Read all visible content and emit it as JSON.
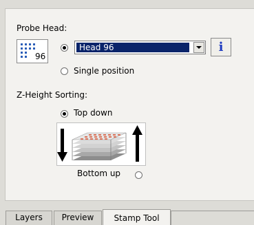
{
  "probe_head": {
    "label": "Probe Head:",
    "icon_number": "96",
    "selected_head": "Head 96",
    "single_position_label": "Single position",
    "info_label": "i",
    "mode": "head"
  },
  "z_height": {
    "label": "Z-Height Sorting:",
    "top_down_label": "Top down",
    "bottom_up_label": "Bottom up",
    "selected": "top_down"
  },
  "tabs": [
    {
      "label": "Layers",
      "active": false
    },
    {
      "label": "Preview",
      "active": false
    },
    {
      "label": "Stamp Tool",
      "active": true
    }
  ],
  "colors": {
    "selection_bg": "#0a246a",
    "info_blue": "#1f3cc0",
    "probe_dot": "#2a5db8"
  }
}
